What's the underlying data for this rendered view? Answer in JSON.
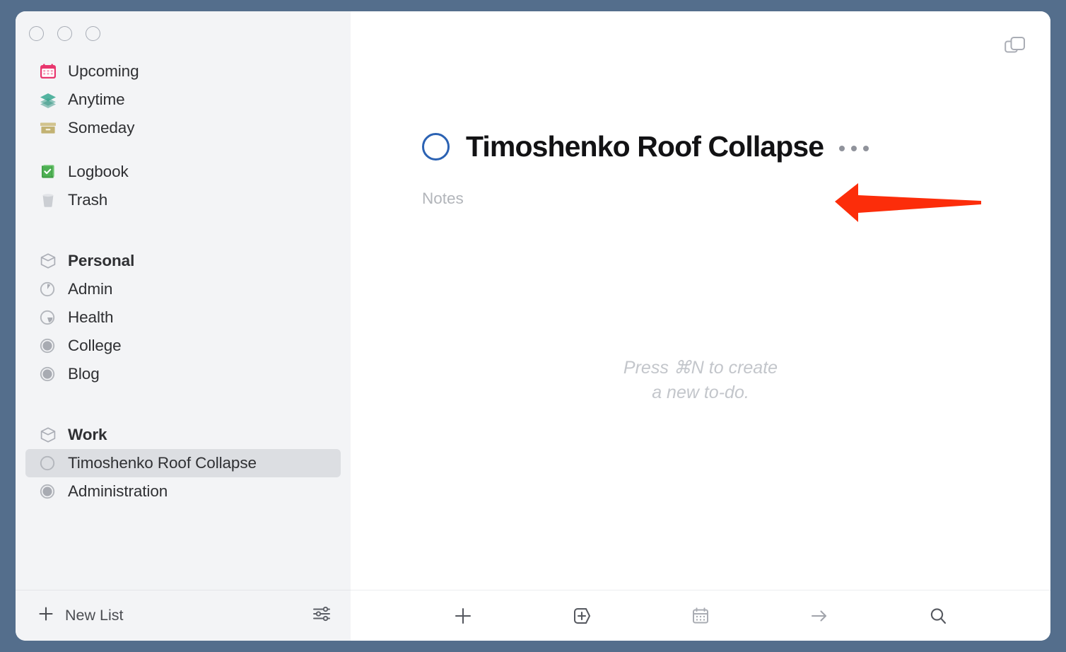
{
  "window": {
    "traffic_lights": [
      {
        "name": "close",
        "label": "Close"
      },
      {
        "name": "minimize",
        "label": "Minimize"
      },
      {
        "name": "zoom",
        "label": "Zoom"
      }
    ],
    "background_color": "#546e8c",
    "sidebar_color": "#f3f4f6",
    "content_color": "#ffffff"
  },
  "sidebar": {
    "smart_lists": [
      {
        "label": "Upcoming",
        "icon": "calendar-icon",
        "icon_color": "#e8366e"
      },
      {
        "label": "Anytime",
        "icon": "layers-icon",
        "icon_color": "#3aa88f"
      },
      {
        "label": "Someday",
        "icon": "box-icon",
        "icon_color": "#c6b375"
      }
    ],
    "system_lists": [
      {
        "label": "Logbook",
        "icon": "logbook-icon",
        "icon_color": "#4cb050"
      },
      {
        "label": "Trash",
        "icon": "trash-icon",
        "icon_color": "#b9bcc1"
      }
    ],
    "areas": [
      {
        "label": "Personal",
        "icon": "area-cube-icon",
        "projects": [
          {
            "label": "Admin",
            "icon": "project-progress-icon",
            "progress": 12,
            "selected": false
          },
          {
            "label": "Health",
            "icon": "project-progress-icon",
            "progress": 30,
            "selected": false
          },
          {
            "label": "College",
            "icon": "project-progress-icon",
            "progress": 100,
            "selected": false
          },
          {
            "label": "Blog",
            "icon": "project-progress-icon",
            "progress": 100,
            "selected": false
          }
        ]
      },
      {
        "label": "Work",
        "icon": "area-cube-icon",
        "projects": [
          {
            "label": "Timoshenko Roof Collapse",
            "icon": "project-progress-icon",
            "progress": 0,
            "selected": true
          },
          {
            "label": "Administration",
            "icon": "project-progress-icon",
            "progress": 100,
            "selected": false
          }
        ]
      }
    ],
    "footer": {
      "new_list_label": "New List",
      "new_list_icon": "plus-icon",
      "settings_icon": "sliders-icon"
    }
  },
  "content": {
    "copy_window_icon": "copy-windows-icon",
    "todo": {
      "title": "Timoshenko Roof Collapse",
      "checkbox_icon": "checkbox-circle-icon",
      "checkbox_color": "#2b62b3",
      "more_menu_icon": "ellipsis-icon",
      "notes_placeholder": "Notes"
    },
    "empty_state": {
      "line1": "Press ⌘N to create",
      "line2": "a new to-do."
    },
    "toolbar": [
      {
        "name": "new-todo-button",
        "icon": "plus-icon",
        "label": "New To-Do"
      },
      {
        "name": "new-project-button",
        "icon": "plus-hexagon-icon",
        "label": "New Project"
      },
      {
        "name": "schedule-button",
        "icon": "calendar-icon",
        "label": "When"
      },
      {
        "name": "move-button",
        "icon": "arrow-right-icon",
        "label": "Move"
      },
      {
        "name": "search-button",
        "icon": "search-icon",
        "label": "Search"
      }
    ]
  },
  "annotation": {
    "arrow": {
      "name": "red-pointer-arrow",
      "color": "#fc2d0a",
      "direction": "left",
      "points_to": "Notes"
    },
    "tick_color": "#fc4124"
  }
}
